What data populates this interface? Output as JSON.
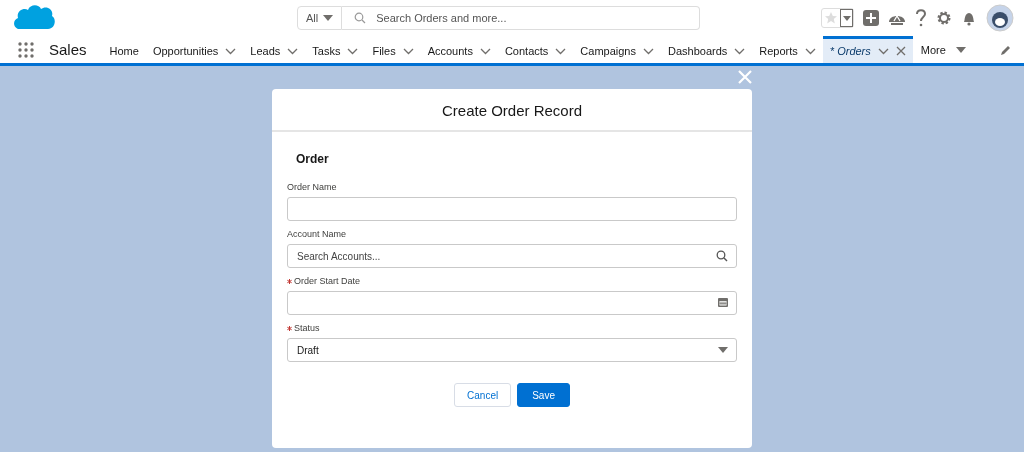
{
  "header": {
    "search_scope": "All",
    "search": {
      "placeholder": "Search Orders and more..."
    }
  },
  "app_name": "Sales",
  "tabs": [
    {
      "label": "Home",
      "dropdown": false,
      "selected": false,
      "closable": false
    },
    {
      "label": "Opportunities",
      "dropdown": true,
      "selected": false,
      "closable": false
    },
    {
      "label": "Leads",
      "dropdown": true,
      "selected": false,
      "closable": false
    },
    {
      "label": "Tasks",
      "dropdown": true,
      "selected": false,
      "closable": false
    },
    {
      "label": "Files",
      "dropdown": true,
      "selected": false,
      "closable": false
    },
    {
      "label": "Accounts",
      "dropdown": true,
      "selected": false,
      "closable": false
    },
    {
      "label": "Contacts",
      "dropdown": true,
      "selected": false,
      "closable": false
    },
    {
      "label": "Campaigns",
      "dropdown": true,
      "selected": false,
      "closable": false
    },
    {
      "label": "Dashboards",
      "dropdown": true,
      "selected": false,
      "closable": false
    },
    {
      "label": "Reports",
      "dropdown": true,
      "selected": false,
      "closable": false
    },
    {
      "label": "* Orders",
      "dropdown": true,
      "selected": true,
      "closable": true
    }
  ],
  "more": "More",
  "modal": {
    "title": "Create Order Record",
    "section": "Order",
    "fields": [
      {
        "kind": "text",
        "label": "Order Name",
        "required": false
      },
      {
        "kind": "lookup",
        "label": "Account Name",
        "required": false,
        "placeholder": "Search Accounts..."
      },
      {
        "kind": "date",
        "label": "Order Start Date",
        "required": true
      },
      {
        "kind": "picklist",
        "label": "Status",
        "required": true,
        "value": "Draft"
      }
    ],
    "buttons": [
      {
        "label": "Cancel",
        "kind": "neutral"
      },
      {
        "label": "Save",
        "kind": "brand"
      }
    ]
  }
}
